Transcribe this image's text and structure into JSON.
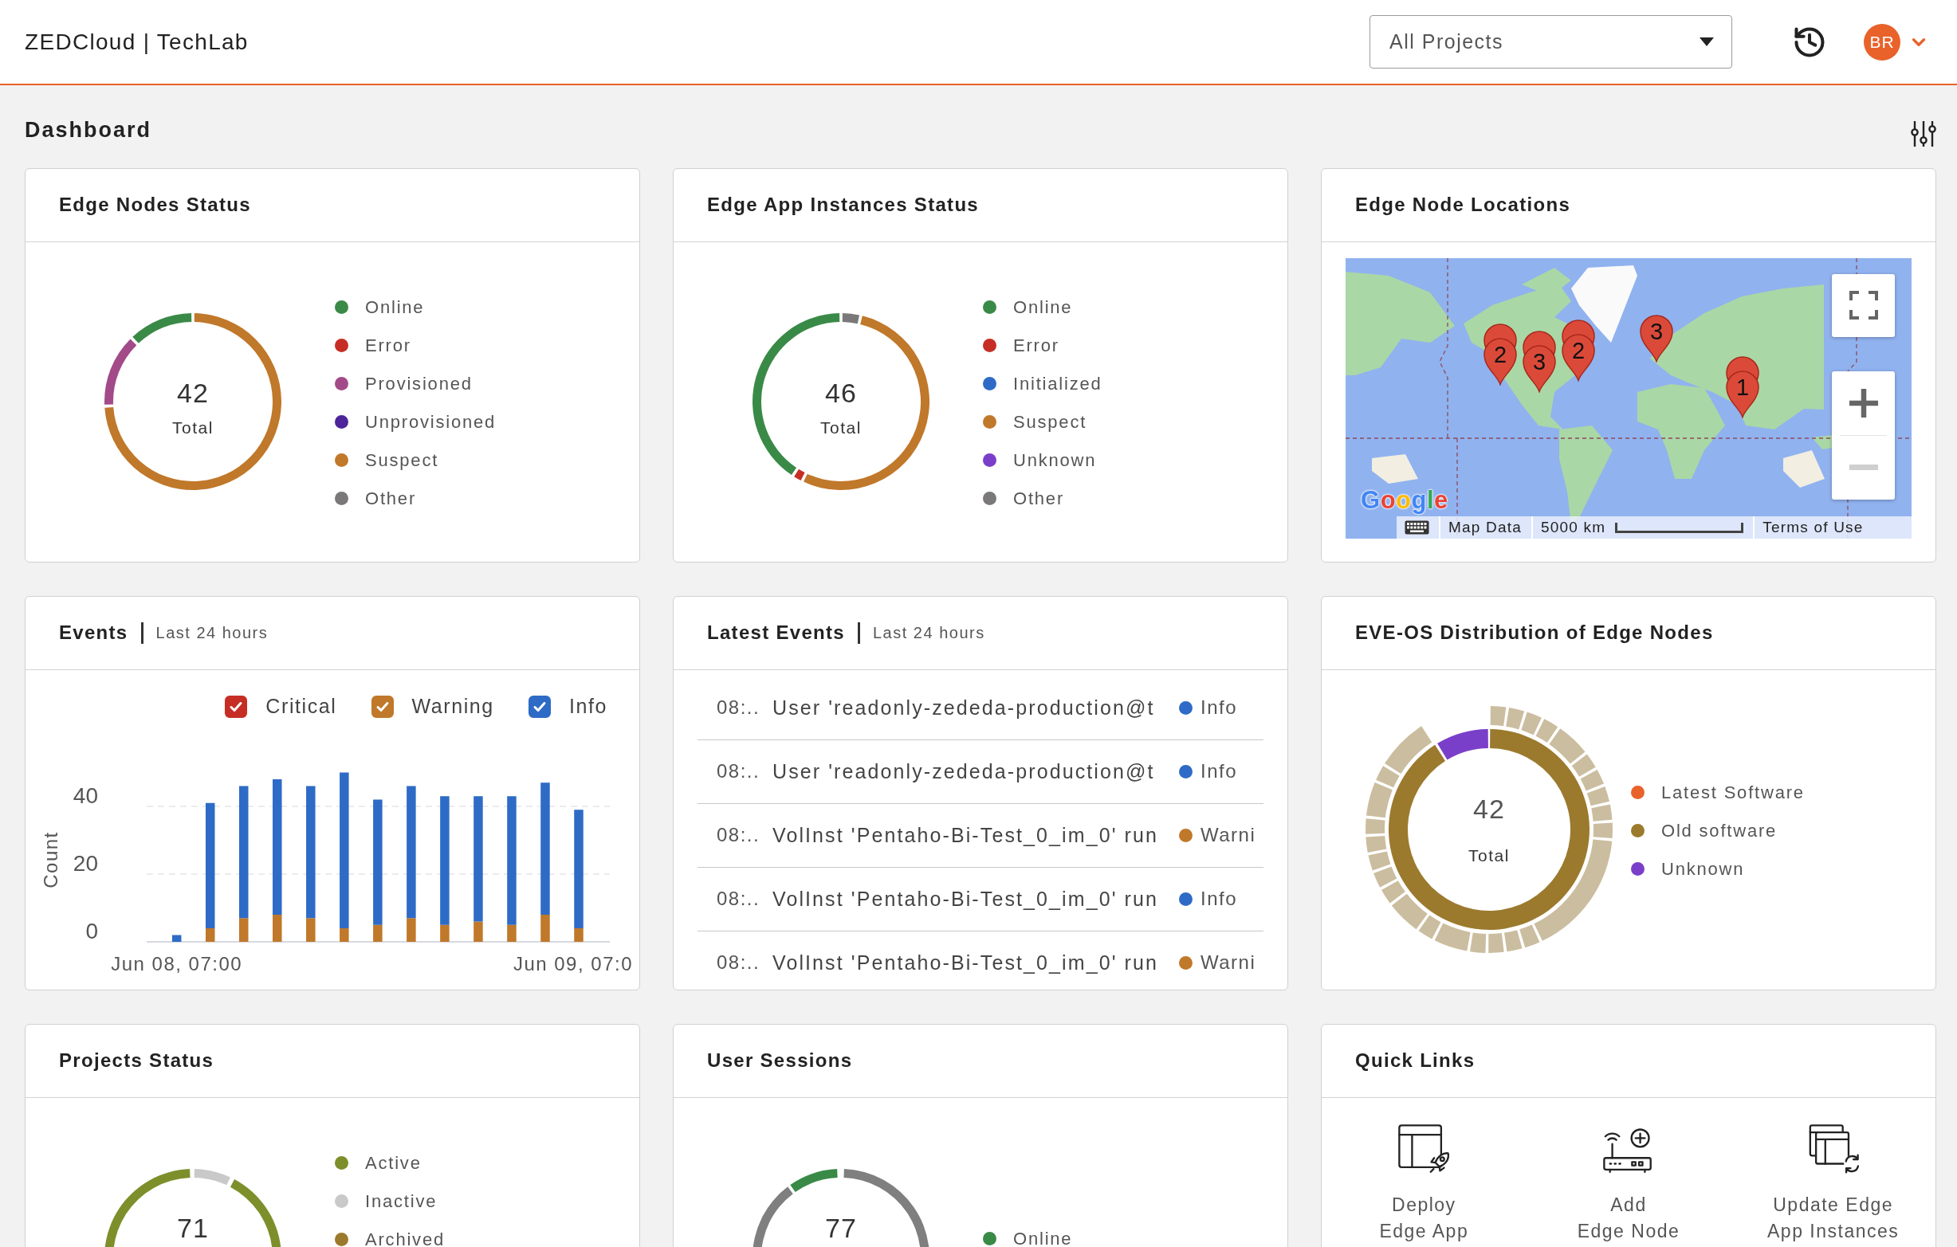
{
  "header": {
    "title": "ZEDCloud | TechLab",
    "project_select": "All Projects",
    "avatar": "BR"
  },
  "page_title": "Dashboard",
  "cards": [
    {
      "kind": "donut",
      "title": "Edge Nodes Status",
      "total": "42",
      "total_label": "Total",
      "legend": [
        {
          "label": "Online",
          "color": "#3a8a47"
        },
        {
          "label": "Error",
          "color": "#c62e25"
        },
        {
          "label": "Provisioned",
          "color": "#a34a88"
        },
        {
          "label": "Unprovisioned",
          "color": "#4d249a"
        },
        {
          "label": "Suspect",
          "color": "#c0782a"
        },
        {
          "label": "Other",
          "color": "#7a7878"
        }
      ]
    },
    {
      "kind": "donut",
      "title": "Edge App Instances Status",
      "total": "46",
      "total_label": "Total",
      "legend": [
        {
          "label": "Online",
          "color": "#3a8a47"
        },
        {
          "label": "Error",
          "color": "#c62e25"
        },
        {
          "label": "Initialized",
          "color": "#2e6bc6"
        },
        {
          "label": "Suspect",
          "color": "#c0782a"
        },
        {
          "label": "Unknown",
          "color": "#7a3fc9"
        },
        {
          "label": "Other",
          "color": "#7a7878"
        }
      ]
    },
    {
      "kind": "map",
      "title": "Edge Node Locations",
      "markers": [
        {
          "label": "2"
        },
        {
          "label": "3"
        },
        {
          "label": "2"
        },
        {
          "label": "3"
        },
        {
          "label": "1"
        }
      ],
      "zoom_controls": [
        {
          "kind": "in",
          "disabled": false
        },
        {
          "kind": "out",
          "disabled": true
        }
      ],
      "logo": "Google",
      "attribution": {
        "map_data": "Map Data",
        "scale": "5000 km",
        "terms": "Terms of Use"
      }
    },
    {
      "kind": "events_chart",
      "title": "Events",
      "subtitle": "Last 24 hours",
      "legend": [
        {
          "checked": true
        },
        {
          "checked": true
        },
        {
          "checked": true
        }
      ],
      "chart_data": {
        "type": "bar",
        "stacked": true,
        "legend": "top",
        "ylabel": "Count",
        "categories": [
          "Jun 08, 07:00",
          null,
          null,
          null,
          null,
          null,
          null,
          null,
          null,
          null,
          null,
          null,
          "Jun 09, 07:0"
        ],
        "yticks": [
          0,
          20,
          40
        ],
        "ylim": [
          0,
          50
        ],
        "series": [
          {
            "name": "Critical",
            "color": "#c62e25",
            "values": [
              0,
              0,
              0,
              0,
              0,
              0,
              0,
              0,
              0,
              0,
              0,
              0,
              0
            ]
          },
          {
            "name": "Warning",
            "color": "#c0782a",
            "values": [
              0,
              4,
              7,
              8,
              7,
              4,
              5,
              7,
              5,
              6,
              5,
              8,
              4
            ]
          },
          {
            "name": "Info",
            "color": "#2e6bc6",
            "values": [
              2,
              37,
              39,
              40,
              39,
              46,
              37,
              39,
              38,
              37,
              38,
              39,
              35
            ]
          }
        ]
      }
    },
    {
      "kind": "event_list",
      "title": "Latest Events",
      "subtitle": "Last 24 hours",
      "rows": [
        {
          "time": "08:..",
          "message": "User 'readonly-zededa-production@t",
          "level": "Info",
          "color": "#2e6bc6"
        },
        {
          "time": "08:..",
          "message": "User 'readonly-zededa-production@t",
          "level": "Info",
          "color": "#2e6bc6"
        },
        {
          "time": "08:..",
          "message": "VolInst 'Pentaho-Bi-Test_0_im_0' run",
          "level": "Warni",
          "color": "#c0782a"
        },
        {
          "time": "08:..",
          "message": "VolInst 'Pentaho-Bi-Test_0_im_0' run",
          "level": "Info",
          "color": "#2e6bc6"
        },
        {
          "time": "08:..",
          "message": "VolInst 'Pentaho-Bi-Test_0_im_0' run",
          "level": "Warni",
          "color": "#c0782a"
        }
      ]
    },
    {
      "kind": "sunburst",
      "title": "EVE-OS Distribution of Edge Nodes",
      "total": "42",
      "total_label": "Total",
      "legend": [
        {
          "label": "Latest Software",
          "color": "#e8622a"
        },
        {
          "label": "Old software",
          "color": "#9b7a2e"
        },
        {
          "label": "Unknown",
          "color": "#7a3fc9"
        }
      ]
    },
    {
      "kind": "donut",
      "title": "Projects Status",
      "total": "71",
      "legend": [
        {
          "label": "Active",
          "color": "#7d8f2b"
        },
        {
          "label": "Inactive",
          "color": "#c9c9c9"
        },
        {
          "label": "Archived",
          "color": "#9b7a2e"
        }
      ]
    },
    {
      "kind": "donut",
      "title": "User Sessions",
      "total": "77",
      "legend": [
        {
          "label": "Online",
          "color": "#3a8a47"
        }
      ]
    },
    {
      "kind": "quick_links",
      "title": "Quick Links",
      "links": [
        {
          "kind": "deploy_app",
          "lines": [
            "Deploy",
            "Edge App"
          ]
        },
        {
          "kind": "add_node",
          "lines": [
            "Add",
            "Edge Node"
          ]
        },
        {
          "kind": "update_instances",
          "lines": [
            "Update Edge",
            "App Instances"
          ]
        }
      ]
    }
  ]
}
